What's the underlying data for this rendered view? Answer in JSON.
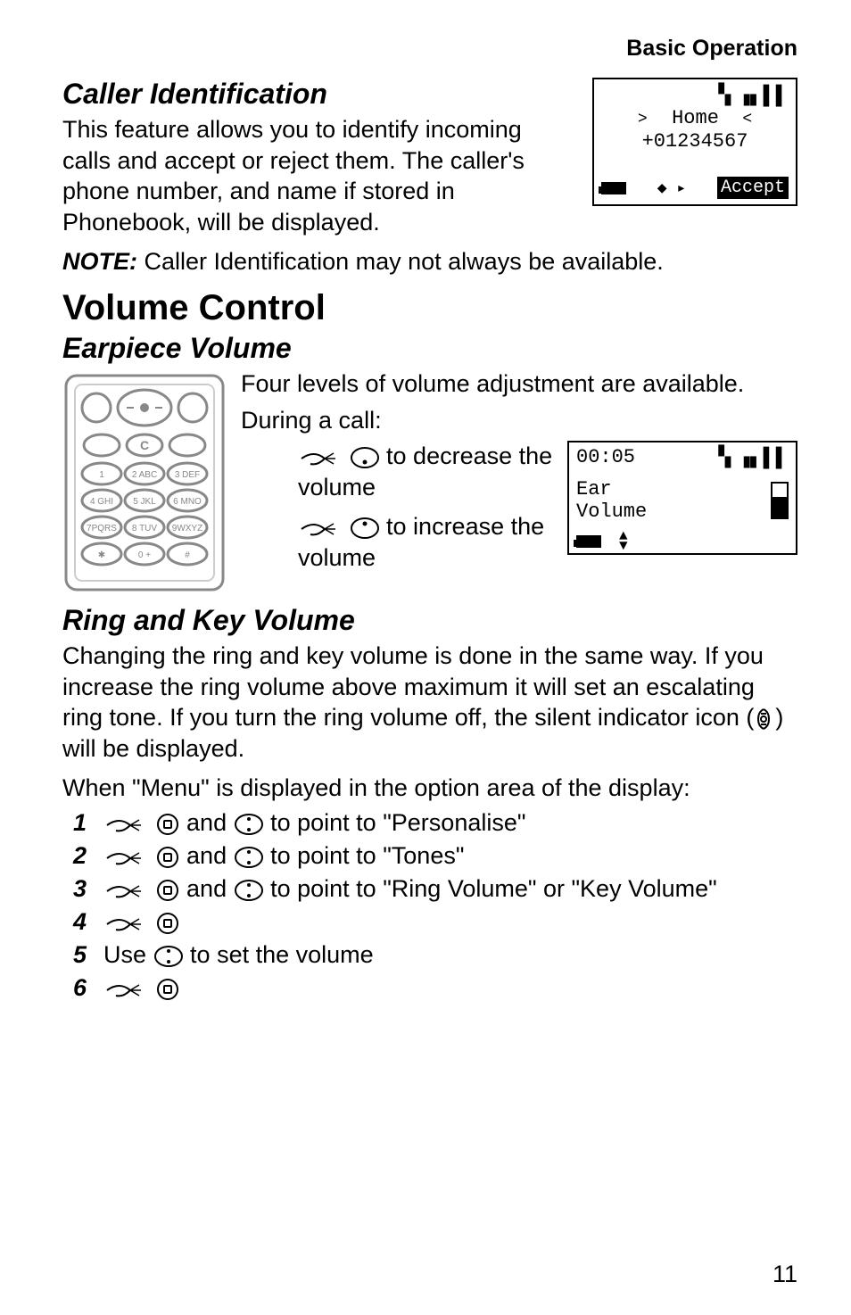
{
  "header": {
    "section": "Basic Operation"
  },
  "caller_id": {
    "heading": "Caller Identification",
    "para": "This feature allows you to identify incoming calls and accept or reject them. The caller's phone number, and name if stored in Phonebook, will be displayed.",
    "note_label": "NOTE:",
    "note_text": " Caller Identification may not always be available."
  },
  "screen1": {
    "signal": "▝▖▗▖▌▌",
    "home_line": "Home",
    "number": "+01234567",
    "accept": "Accept"
  },
  "volume": {
    "heading": "Volume Control",
    "earpiece_heading": "Earpiece Volume",
    "intro": "Four levels of volume adjustment are available.",
    "during": "During a call:",
    "decrease": " to decrease the volume",
    "increase": " to increase the volume"
  },
  "screen2": {
    "time": "00:05",
    "signal": "▝▖▗▖▌▌",
    "line1": "Ear",
    "line2": "Volume"
  },
  "ring": {
    "heading": "Ring and Key Volume",
    "para": "Changing the ring and key volume is done in the same way. If you increase the ring volume above maximum it will set an escalating ring tone. If you turn the ring volume off, the silent indicator icon (",
    "para2": ") will be displayed.",
    "when_menu": "When \"Menu\" is displayed in the option area of the display:",
    "steps": {
      "s1a": " and ",
      "s1b": " to point to \"Personalise\"",
      "s2a": " and ",
      "s2b": " to point to \"Tones\"",
      "s3a": " and ",
      "s3b": " to point to \"Ring Volume\" or \"Key Volume\"",
      "s5a": "Use ",
      "s5b": " to set the volume"
    }
  },
  "page_number": "11"
}
